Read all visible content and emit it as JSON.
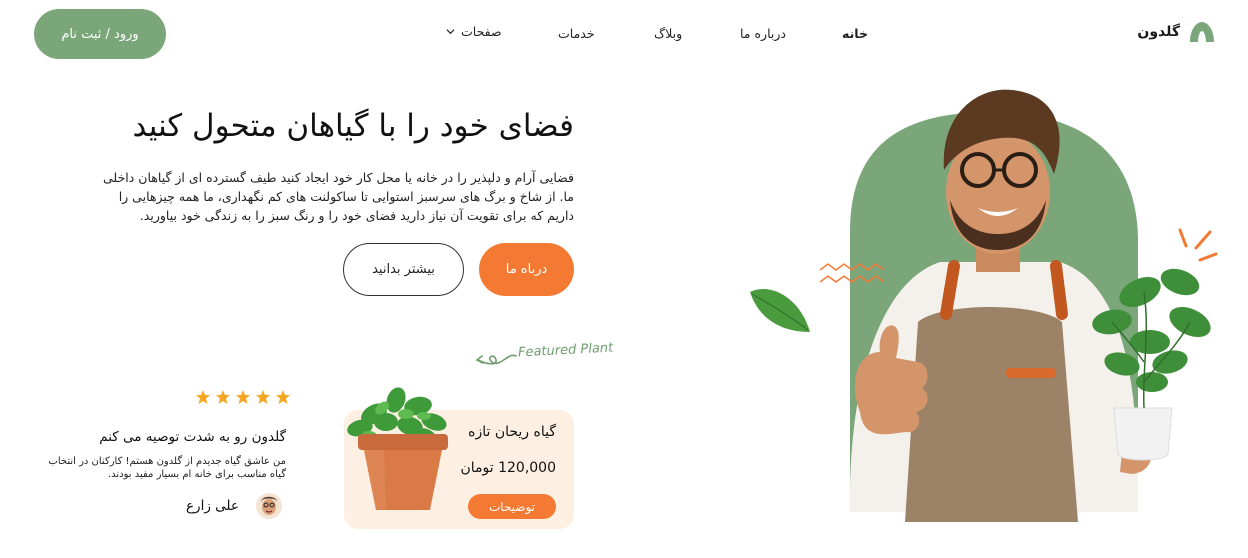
{
  "nav": {
    "brand": "گلدون",
    "items": [
      {
        "label": "خانه",
        "active": true
      },
      {
        "label": "درباره ما",
        "active": false
      },
      {
        "label": "وبلاگ",
        "active": false
      },
      {
        "label": "خدمات",
        "active": false
      },
      {
        "label": "صفحات",
        "active": false,
        "dropdown": true
      }
    ],
    "login_label": "ورود / ثبت نام"
  },
  "hero": {
    "title": "فضای خود را با گیاهان متحول کنید",
    "description": "فضایی آرام و دلپذیر را در خانه یا محل کار خود ایجاد کنید طیف گسترده ای از گیاهان داخلی ما. از شاخ و برگ های سرسبز استوایی تا ساکولنت های کم نگهداری، ما همه چیزهایی را داریم که برای تقویت آن نیاز دارید فضای خود را و رنگ سبز را به زندگی خود بیاورید.",
    "primary_button": "درباه ما",
    "secondary_button": "بیشتر بدانید"
  },
  "featured": {
    "label": "Featured Plant",
    "product_name": "گیاه ریحان تازه",
    "price": "120,000 تومان",
    "button": "توضیحات"
  },
  "testimonial": {
    "rating": 5,
    "title": "گلدون رو به شدت توصیه می کنم",
    "text": "من عاشق گیاه جدیدم از گلدون هستم! کارکنان در انتخاب گیاه مناسب برای خانه ام بسیار مفید بودند.",
    "author": "علی زارع"
  },
  "colors": {
    "accent_green": "#7aa67a",
    "accent_orange": "#f47a34",
    "card_bg": "#fdf0e3",
    "star": "#f5a623"
  }
}
